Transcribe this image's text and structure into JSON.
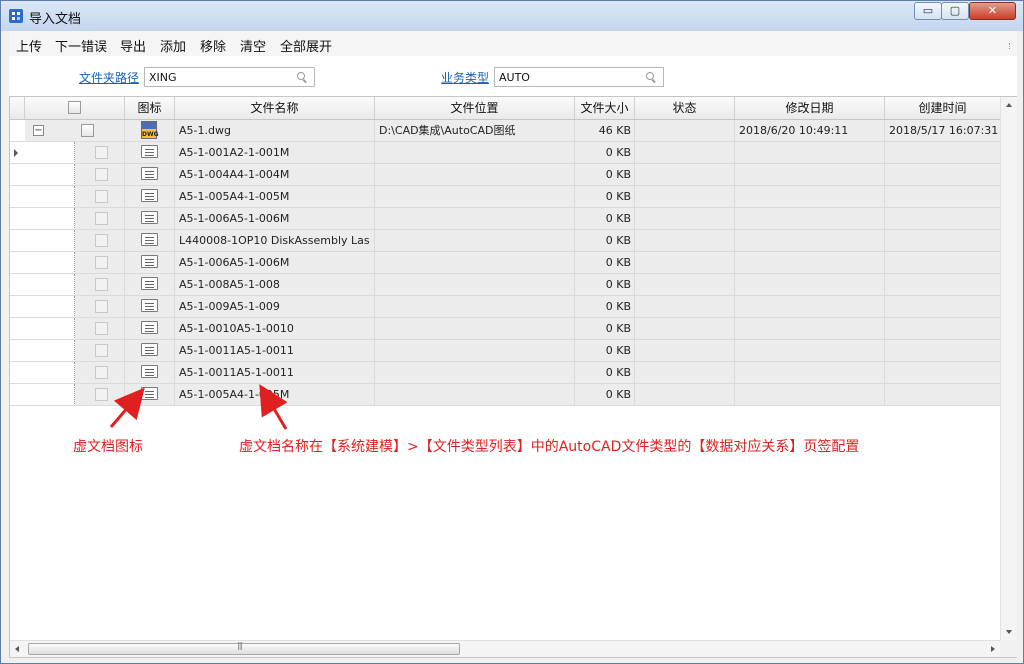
{
  "window": {
    "title": "导入文档",
    "controls": {
      "minimize": "▭",
      "maximize": "▢",
      "close": "✕"
    }
  },
  "menu": {
    "items": [
      "上传",
      "下一错误",
      "导出",
      "添加",
      "移除",
      "清空",
      "全部展开"
    ]
  },
  "filter": {
    "folder_path_label": "文件夹路径",
    "folder_path_value": "XING",
    "business_type_label": "业务类型",
    "business_type_value": "AUTO"
  },
  "table": {
    "columns": [
      "",
      "图标",
      "文件名称",
      "文件位置",
      "文件大小",
      "状态",
      "修改日期",
      "创建时间"
    ],
    "parent": {
      "name": "A5-1.dwg",
      "location": "D:\\CAD集成\\AutoCAD图纸",
      "size": "46 KB",
      "status": "",
      "modified": "2018/6/20 10:49:11",
      "created": "2018/5/17 16:07:31",
      "icon": "dwg-file-icon"
    },
    "children": [
      {
        "name": "A5-1-001A2-1-001M",
        "size": "0 KB"
      },
      {
        "name": "A5-1-004A4-1-004M",
        "size": "0 KB"
      },
      {
        "name": "A5-1-005A4-1-005M",
        "size": "0 KB"
      },
      {
        "name": "A5-1-006A5-1-006M",
        "size": "0 KB"
      },
      {
        "name": "L440008-1OP10 DiskAssembly Las",
        "size": "0 KB"
      },
      {
        "name": "A5-1-006A5-1-006M",
        "size": "0 KB"
      },
      {
        "name": "A5-1-008A5-1-008",
        "size": "0 KB"
      },
      {
        "name": "A5-1-009A5-1-009",
        "size": "0 KB"
      },
      {
        "name": "A5-1-0010A5-1-0010",
        "size": "0 KB"
      },
      {
        "name": "A5-1-0011A5-1-0011",
        "size": "0 KB"
      },
      {
        "name": "A5-1-0011A5-1-0011",
        "size": "0 KB"
      },
      {
        "name": "A5-1-005A4-1-005M",
        "size": "0 KB"
      }
    ]
  },
  "annotations": {
    "icon_note": "虚文档图标",
    "name_note": "虚文档名称在【系统建模】>【文件类型列表】中的AutoCAD文件类型的【数据对应关系】页签配置",
    "color": "#e02020"
  }
}
